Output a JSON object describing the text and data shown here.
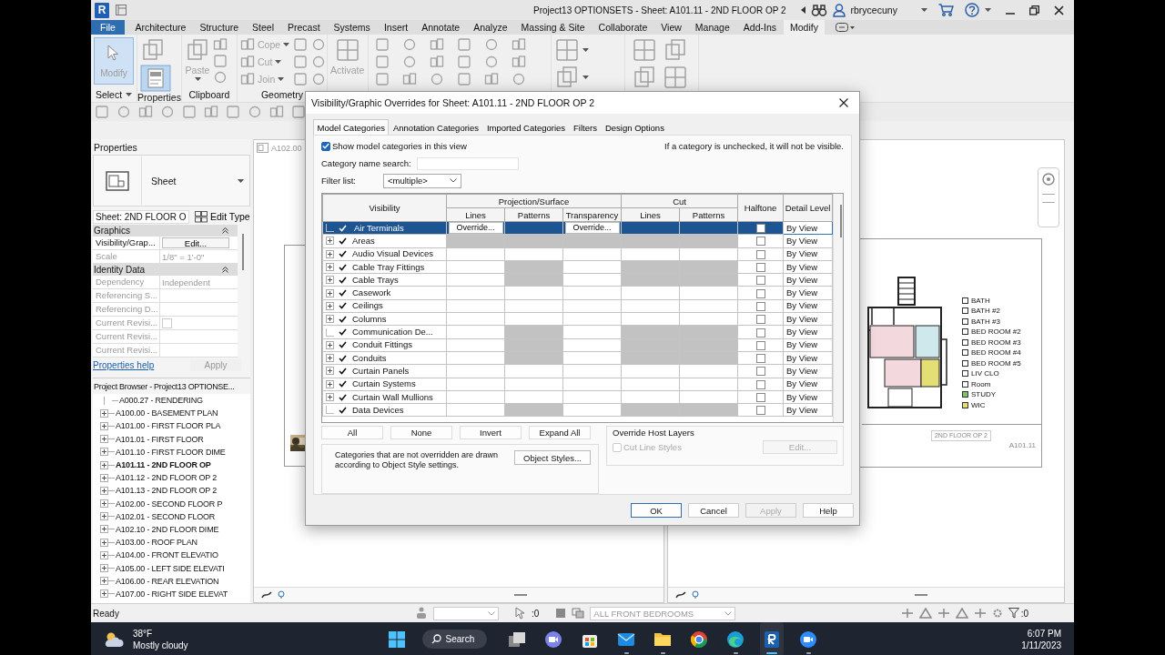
{
  "window": {
    "logo": "R",
    "title": "Project13 OPTIONSETS - Sheet: A101.11 - 2ND FLOOR OP 2",
    "user": "rbrycecuny"
  },
  "ribbon": {
    "tabs": [
      {
        "label": "File",
        "kind": "file",
        "selected": false
      },
      {
        "label": "Architecture",
        "kind": "tab",
        "selected": false
      },
      {
        "label": "Structure",
        "kind": "tab",
        "selected": false
      },
      {
        "label": "Steel",
        "kind": "tab",
        "selected": false
      },
      {
        "label": "Precast",
        "kind": "tab",
        "selected": false
      },
      {
        "label": "Systems",
        "kind": "tab",
        "selected": false
      },
      {
        "label": "Insert",
        "kind": "tab",
        "selected": false
      },
      {
        "label": "Annotate",
        "kind": "tab",
        "selected": false
      },
      {
        "label": "Analyze",
        "kind": "tab",
        "selected": false
      },
      {
        "label": "Massing & Site",
        "kind": "tab",
        "selected": false
      },
      {
        "label": "Collaborate",
        "kind": "tab",
        "selected": false
      },
      {
        "label": "View",
        "kind": "tab",
        "selected": false
      },
      {
        "label": "Manage",
        "kind": "tab",
        "selected": false
      },
      {
        "label": "Add-Ins",
        "kind": "tab",
        "selected": false
      },
      {
        "label": "Modify",
        "kind": "tab",
        "selected": true
      }
    ],
    "panels": [
      {
        "kind": "select",
        "label": "Select",
        "tools": [
          "Modify"
        ],
        "selected": true
      },
      {
        "kind": "properties",
        "label": "Properties",
        "selected": true
      },
      {
        "kind": "clipboard",
        "label": "Clipboard",
        "tools": [
          "Paste"
        ]
      },
      {
        "kind": "geometry",
        "label": "Geometry",
        "tools": [
          "Cope",
          "Cut",
          "Join"
        ]
      },
      {
        "kind": "controls",
        "tools": [
          "Activate"
        ]
      },
      {
        "kind": "modify"
      },
      {
        "kind": "measure"
      },
      {
        "kind": "create"
      }
    ]
  },
  "properties": {
    "title": "Properties",
    "type": "Sheet",
    "instance": "Sheet: 2ND FLOOR O",
    "edit_type": "Edit Type",
    "groups": [
      {
        "label": "Graphics",
        "rows": [
          {
            "name": "Visibility/Grap...",
            "value": "Edit...",
            "kind": "button",
            "disabled": false
          },
          {
            "name": "Scale",
            "value": "1/8\" = 1'-0\"",
            "kind": "text",
            "disabled": true
          }
        ]
      },
      {
        "label": "Identity Data",
        "rows": [
          {
            "name": "Dependency",
            "value": "Independent",
            "kind": "text",
            "disabled": true
          },
          {
            "name": "Referencing S...",
            "kind": "text",
            "disabled": true
          },
          {
            "name": "Referencing D...",
            "kind": "text",
            "disabled": true
          },
          {
            "name": "Current Revisi...",
            "kind": "checkbox",
            "checked": false,
            "disabled": true
          },
          {
            "name": "Current Revisi...",
            "kind": "text",
            "disabled": true
          },
          {
            "name": "Current Revisi...",
            "kind": "text",
            "disabled": true
          }
        ]
      }
    ],
    "help": "Properties help",
    "apply": "Apply"
  },
  "browser": {
    "title": "Project Browser - Project13 OPTIONSE...",
    "items": [
      {
        "label": "A000.27 - RENDERING",
        "expandable": false,
        "selected": false
      },
      {
        "label": "A100.00 - BASEMENT PLAN",
        "expandable": true,
        "selected": false
      },
      {
        "label": "A101.00 - FIRST FLOOR PLA",
        "expandable": true,
        "selected": false
      },
      {
        "label": "A101.01 - FIRST FLOOR",
        "expandable": true,
        "selected": false
      },
      {
        "label": "A101.10 - FIRST FLOOR DIME",
        "expandable": true,
        "selected": false
      },
      {
        "label": "A101.11 - 2ND FLOOR OP",
        "expandable": true,
        "selected": true
      },
      {
        "label": "A101.12 - 2ND FLOOR OP 2",
        "expandable": true,
        "selected": false
      },
      {
        "label": "A101.13 - 2ND FLOOR OP 2",
        "expandable": true,
        "selected": false
      },
      {
        "label": "A102.00 - SECOND FLOOR P",
        "expandable": true,
        "selected": false
      },
      {
        "label": "A102.01 - SECOND FLOOR",
        "expandable": true,
        "selected": false
      },
      {
        "label": "A102.10 - 2ND FLOOR DIME",
        "expandable": true,
        "selected": false
      },
      {
        "label": "A103.00 - ROOF PLAN",
        "expandable": true,
        "selected": false
      },
      {
        "label": "A104.00 - FRONT ELEVATIO",
        "expandable": true,
        "selected": false
      },
      {
        "label": "A105.00 - LEFT SIDE ELEVATI",
        "expandable": true,
        "selected": false
      },
      {
        "label": "A106.00 - REAR ELEVATION",
        "expandable": true,
        "selected": false
      },
      {
        "label": "A107.00 - RIGHT SIDE ELEVAT",
        "expandable": true,
        "selected": false
      }
    ]
  },
  "views": {
    "left": {
      "tab": "A102.00"
    },
    "right": {
      "legend": [
        {
          "label": "BATH",
          "color": "#ffffff"
        },
        {
          "label": "BATH #2",
          "color": "#ffffff"
        },
        {
          "label": "BATH #3",
          "color": "#ffffff"
        },
        {
          "label": "BED ROOM #2",
          "color": "#ffffff"
        },
        {
          "label": "BED ROOM #3",
          "color": "#ffffff"
        },
        {
          "label": "BED ROOM #4",
          "color": "#ffffff"
        },
        {
          "label": "BED ROOM #5",
          "color": "#ffffff"
        },
        {
          "label": "LIV CLO",
          "color": "#ffffff"
        },
        {
          "label": "Room",
          "color": "#ffffff"
        },
        {
          "label": "STUDY",
          "color": "#7cc46a"
        },
        {
          "label": "WIC",
          "color": "#e3df74"
        }
      ],
      "sheet_title": "2ND FLOOR OP 2",
      "sheet_number": "A101.11"
    }
  },
  "status_bar": {
    "status": "Ready",
    "selection_count": ":0",
    "design_option": "ALL FRONT BEDROOMS",
    "filter_count": ":0"
  },
  "taskbar": {
    "temperature": "38°F",
    "weather": "Mostly cloudy",
    "search": "Search",
    "apps": [
      {
        "kind": "taskview",
        "running": false,
        "active": false
      },
      {
        "kind": "chat",
        "running": false,
        "active": false
      },
      {
        "kind": "store",
        "running": false,
        "active": false
      },
      {
        "kind": "mail",
        "running": true,
        "active": false
      },
      {
        "kind": "folder",
        "running": true,
        "active": false
      },
      {
        "kind": "browser1",
        "running": false,
        "active": false
      },
      {
        "kind": "browser2",
        "running": true,
        "active": false
      },
      {
        "kind": "revit",
        "running": true,
        "active": true
      },
      {
        "kind": "video",
        "running": true,
        "active": false
      }
    ],
    "time": "6:07 PM",
    "date": "1/11/2023"
  },
  "dialog": {
    "title": "Visibility/Graphic Overrides for Sheet: A101.11 - 2ND FLOOR OP 2",
    "tabs": [
      {
        "label": "Model Categories",
        "selected": true
      },
      {
        "label": "Annotation Categories",
        "selected": false
      },
      {
        "label": "Imported Categories",
        "selected": false
      },
      {
        "label": "Filters",
        "selected": false
      },
      {
        "label": "Design Options",
        "selected": false
      }
    ],
    "show_categories": {
      "label": "Show model categories in this view",
      "checked": true
    },
    "hint": "If a category is unchecked, it will not be visible.",
    "search": {
      "label": "Category name search:"
    },
    "filter": {
      "label": "Filter list:",
      "value": "<multiple>"
    },
    "columns": {
      "visibility": "Visibility",
      "projection": "Projection/Surface",
      "projection_columns": [
        "Lines",
        "Patterns",
        "Transparency"
      ],
      "cut": "Cut",
      "cut_columns": [
        "Lines",
        "Patterns"
      ],
      "halftone": "Halftone",
      "detail_level": "Detail Level"
    },
    "rows": [
      {
        "name": "Air Terminals",
        "expandable": false,
        "visible": true,
        "selected": true,
        "cells": [
          {
            "button": "Override..."
          },
          {},
          {
            "button": "Override..."
          },
          {},
          {}
        ],
        "halftone": false,
        "detail_level": "By View"
      },
      {
        "name": "Areas",
        "expandable": true,
        "visible": true,
        "selected": false,
        "cells": [
          {
            "disabled": true
          },
          {
            "disabled": true
          },
          {
            "disabled": true
          },
          {
            "disabled": true
          },
          {
            "disabled": true
          }
        ],
        "halftone": false,
        "detail_level": "By View"
      },
      {
        "name": "Audio Visual Devices",
        "expandable": true,
        "visible": true,
        "selected": false,
        "cells": [
          {
            "disabled": false
          },
          {
            "disabled": false
          },
          {
            "disabled": false
          },
          {
            "disabled": false
          },
          {
            "disabled": false
          }
        ],
        "halftone": false,
        "detail_level": "By View"
      },
      {
        "name": "Cable Tray Fittings",
        "expandable": true,
        "visible": true,
        "selected": false,
        "cells": [
          {
            "disabled": false
          },
          {
            "disabled": true
          },
          {
            "disabled": false
          },
          {
            "disabled": true
          },
          {
            "disabled": true
          }
        ],
        "halftone": false,
        "detail_level": "By View"
      },
      {
        "name": "Cable Trays",
        "expandable": true,
        "visible": true,
        "selected": false,
        "cells": [
          {
            "disabled": false
          },
          {
            "disabled": true
          },
          {
            "disabled": false
          },
          {
            "disabled": true
          },
          {
            "disabled": true
          }
        ],
        "halftone": false,
        "detail_level": "By View"
      },
      {
        "name": "Casework",
        "expandable": true,
        "visible": true,
        "selected": false,
        "cells": [
          {
            "disabled": false
          },
          {
            "disabled": false
          },
          {
            "disabled": false
          },
          {
            "disabled": false
          },
          {
            "disabled": false
          }
        ],
        "halftone": false,
        "detail_level": "By View"
      },
      {
        "name": "Ceilings",
        "expandable": true,
        "visible": true,
        "selected": false,
        "cells": [
          {
            "disabled": false
          },
          {
            "disabled": false
          },
          {
            "disabled": false
          },
          {
            "disabled": false
          },
          {
            "disabled": false
          }
        ],
        "halftone": false,
        "detail_level": "By View"
      },
      {
        "name": "Columns",
        "expandable": true,
        "visible": true,
        "selected": false,
        "cells": [
          {
            "disabled": false
          },
          {
            "disabled": false
          },
          {
            "disabled": false
          },
          {
            "disabled": false
          },
          {
            "disabled": false
          }
        ],
        "halftone": false,
        "detail_level": "By View"
      },
      {
        "name": "Communication De...",
        "expandable": false,
        "visible": true,
        "selected": false,
        "cells": [
          {
            "disabled": false
          },
          {
            "disabled": true
          },
          {
            "disabled": false
          },
          {
            "disabled": true
          },
          {
            "disabled": true
          }
        ],
        "halftone": false,
        "detail_level": "By View"
      },
      {
        "name": "Conduit Fittings",
        "expandable": true,
        "visible": true,
        "selected": false,
        "cells": [
          {
            "disabled": false
          },
          {
            "disabled": true
          },
          {
            "disabled": false
          },
          {
            "disabled": true
          },
          {
            "disabled": true
          }
        ],
        "halftone": false,
        "detail_level": "By View"
      },
      {
        "name": "Conduits",
        "expandable": true,
        "visible": true,
        "selected": false,
        "cells": [
          {
            "disabled": false
          },
          {
            "disabled": true
          },
          {
            "disabled": false
          },
          {
            "disabled": true
          },
          {
            "disabled": true
          }
        ],
        "halftone": false,
        "detail_level": "By View"
      },
      {
        "name": "Curtain Panels",
        "expandable": true,
        "visible": true,
        "selected": false,
        "cells": [
          {
            "disabled": false
          },
          {
            "disabled": false
          },
          {
            "disabled": false
          },
          {
            "disabled": false
          },
          {
            "disabled": false
          }
        ],
        "halftone": false,
        "detail_level": "By View"
      },
      {
        "name": "Curtain Systems",
        "expandable": true,
        "visible": true,
        "selected": false,
        "cells": [
          {
            "disabled": false
          },
          {
            "disabled": false
          },
          {
            "disabled": false
          },
          {
            "disabled": false
          },
          {
            "disabled": false
          }
        ],
        "halftone": false,
        "detail_level": "By View"
      },
      {
        "name": "Curtain Wall Mullions",
        "expandable": true,
        "visible": true,
        "selected": false,
        "cells": [
          {
            "disabled": false
          },
          {
            "disabled": false
          },
          {
            "disabled": false
          },
          {
            "disabled": false
          },
          {
            "disabled": false
          }
        ],
        "halftone": false,
        "detail_level": "By View"
      },
      {
        "name": "Data Devices",
        "expandable": false,
        "visible": true,
        "selected": false,
        "cells": [
          {
            "disabled": false
          },
          {
            "disabled": true
          },
          {
            "disabled": false
          },
          {
            "disabled": true
          },
          {
            "disabled": true
          }
        ],
        "halftone": false,
        "detail_level": "By View"
      }
    ],
    "list_buttons": [
      "All",
      "None",
      "Invert",
      "Expand All"
    ],
    "note": "Categories that are not overridden are drawn according to Object Style settings.",
    "object_styles": "Object Styles...",
    "host_layers": {
      "title": "Override Host Layers",
      "checkbox": {
        "label": "Cut Line Styles",
        "checked": false,
        "disabled": true
      },
      "edit": {
        "label": "Edit...",
        "disabled": true
      }
    },
    "buttons": [
      {
        "label": "OK",
        "kind": "default",
        "disabled": false
      },
      {
        "label": "Cancel",
        "kind": "normal",
        "disabled": false
      },
      {
        "label": "Apply",
        "kind": "normal",
        "disabled": true
      },
      {
        "label": "Help",
        "kind": "normal",
        "disabled": false
      }
    ]
  }
}
